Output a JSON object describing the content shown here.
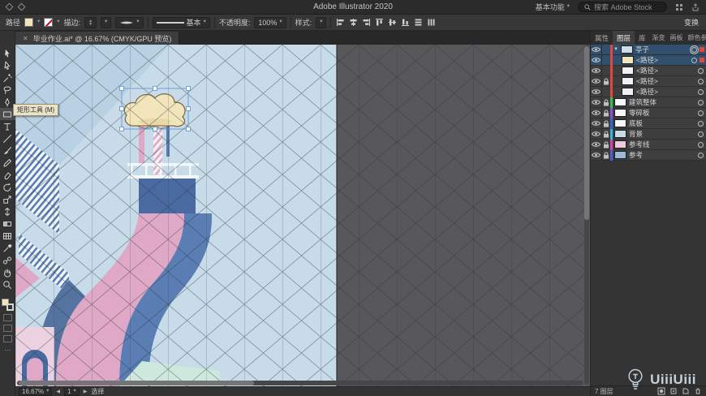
{
  "titlebar": {
    "title": "Adobe Illustrator 2020",
    "workspace": "基本功能",
    "search_placeholder": "搜索 Adobe Stock"
  },
  "controlbar": {
    "context_label": "路径",
    "stroke_label": "描边:",
    "brush_name": "基本",
    "opacity_label": "不透明度:",
    "opacity_value": "100%",
    "style_label": "样式:",
    "transform_label": "变换",
    "colors": {
      "fill": "#f2e4bb",
      "stroke_none_slash": "#d0021b"
    },
    "align_icons": [
      "align-left-icon",
      "align-center-icon",
      "align-right-icon",
      "align-top-icon",
      "align-middle-icon",
      "align-bottom-icon",
      "distribute-vertical-icon",
      "distribute-horizontal-icon"
    ]
  },
  "doc_tab": {
    "close": "✕",
    "title": "毕业作业.ai* @ 16.67% (CMYK/GPU 预览)"
  },
  "tools": {
    "tooltip": "矩形工具 (M)",
    "items": [
      {
        "name": "selection-tool"
      },
      {
        "name": "direct-selection-tool"
      },
      {
        "name": "magic-wand-tool"
      },
      {
        "name": "lasso-tool"
      },
      {
        "name": "pen-tool"
      },
      {
        "name": "rectangle-tool",
        "active": true
      },
      {
        "name": "type-tool"
      },
      {
        "name": "line-segment-tool"
      },
      {
        "name": "paintbrush-tool"
      },
      {
        "name": "pencil-tool"
      },
      {
        "name": "eraser-tool"
      },
      {
        "name": "rotate-tool"
      },
      {
        "name": "scale-tool"
      },
      {
        "name": "width-tool"
      },
      {
        "name": "gradient-tool"
      },
      {
        "name": "mesh-tool"
      },
      {
        "name": "eyedropper-tool"
      },
      {
        "name": "blend-tool"
      },
      {
        "name": "hand-tool"
      },
      {
        "name": "zoom-tool"
      }
    ]
  },
  "artwork": {
    "colors": {
      "sky": "#c7dbe9",
      "sky2": "#b8d1e3",
      "pink": "#dfa8c6",
      "pink_light": "#ecd2e0",
      "blue": "#5a7db3",
      "navy": "#4a6ba1",
      "navy2": "#54749f",
      "cream": "#f2e4bb",
      "cream_stroke": "#7d6d49",
      "teal": "#cfe8dd",
      "white": "#f3f7fa",
      "pasteboard": "#58585a"
    }
  },
  "layers_panel": {
    "tab_groups": [
      [
        "属性",
        "图层",
        "库"
      ],
      [
        "渐变",
        "画板",
        "颜色参"
      ]
    ],
    "active_tab": "图层",
    "rows": [
      {
        "label": "亭子",
        "kind": "group",
        "indent": 0,
        "eye": true,
        "lock": false,
        "color": "#e0483e",
        "thumb": "#cddcea",
        "selected": true,
        "target": "double",
        "sel_square": true
      },
      {
        "label": "<路径>",
        "kind": "path",
        "indent": 1,
        "eye": true,
        "lock": false,
        "color": "#e0483e",
        "thumb": "#f2e4bb",
        "selected": true,
        "target": "single",
        "sel_square": true
      },
      {
        "label": "<路径>",
        "kind": "path",
        "indent": 1,
        "eye": true,
        "lock": false,
        "color": "#e0483e",
        "thumb": "#eef2f6",
        "target": "single"
      },
      {
        "label": "<路径>",
        "kind": "path",
        "indent": 1,
        "eye": true,
        "lock": true,
        "color": "#e0483e",
        "thumb": "#eef2f6",
        "target": "single"
      },
      {
        "label": "<路径>",
        "kind": "path",
        "indent": 1,
        "eye": true,
        "lock": false,
        "color": "#e0483e",
        "thumb": "#eef2f6",
        "target": "single"
      },
      {
        "label": "建筑整体",
        "kind": "layer",
        "indent": 0,
        "eye": true,
        "lock": true,
        "color": "#35c04a",
        "thumb": "#f5f7f9",
        "target": "single"
      },
      {
        "label": "零碎板",
        "kind": "layer",
        "indent": 0,
        "eye": true,
        "lock": true,
        "color": "#8a4fd6",
        "thumb": "#f5f7f9",
        "target": "single"
      },
      {
        "label": "底板",
        "kind": "layer",
        "indent": 0,
        "eye": true,
        "lock": true,
        "color": "#2f66d8",
        "thumb": "#f5f7f9",
        "target": "single"
      },
      {
        "label": "背景",
        "kind": "layer",
        "indent": 0,
        "eye": true,
        "lock": true,
        "color": "#2fb6d8",
        "thumb": "#c7dbe9",
        "target": "single"
      },
      {
        "label": "参考线",
        "kind": "layer",
        "indent": 0,
        "eye": true,
        "lock": true,
        "color": "#d83fae",
        "thumb": "#f0cade",
        "target": "single"
      },
      {
        "label": "参考",
        "kind": "layer",
        "indent": 0,
        "eye": true,
        "lock": true,
        "color": "#4a5fd8",
        "thumb": "#9db9da",
        "target": "single"
      }
    ],
    "footer_count": "7 图层"
  },
  "statusbar": {
    "zoom": "16.67%",
    "artboard_number": "1",
    "status_text": "选择"
  },
  "watermark": {
    "text": "UiiiUiii"
  }
}
